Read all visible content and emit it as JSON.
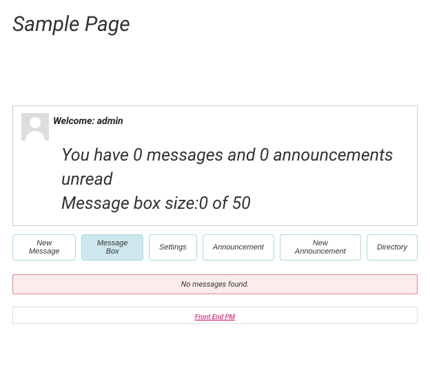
{
  "page": {
    "title": "Sample Page"
  },
  "user": {
    "welcome_prefix": "Welcome: ",
    "name": "admin"
  },
  "summary": {
    "unread_line": "You have 0 messages and 0 announcements unread",
    "box_size_line": "Message box size:0 of 50"
  },
  "tabs": [
    {
      "label": "New Message",
      "active": false
    },
    {
      "label": "Message Box",
      "active": true
    },
    {
      "label": "Settings",
      "active": false
    },
    {
      "label": "Announcement",
      "active": false
    },
    {
      "label": "New Announcement",
      "active": false
    },
    {
      "label": "Directory",
      "active": false
    }
  ],
  "alert": {
    "text": "No messages found."
  },
  "footer": {
    "link_text": "Front End PM"
  }
}
